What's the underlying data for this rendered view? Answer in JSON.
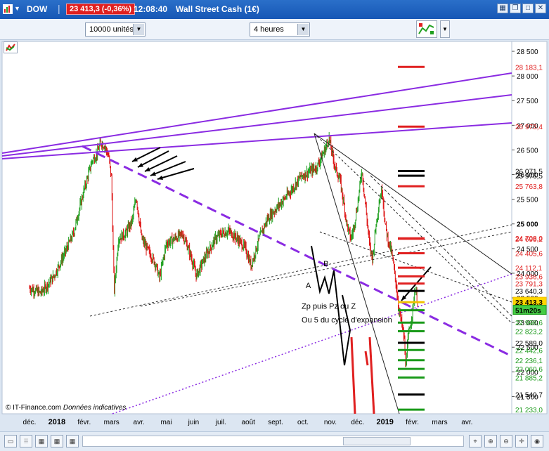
{
  "titlebar": {
    "symbol": "DOW",
    "price_change": "23 413,3 (-0,36%)",
    "time": "12:08:40",
    "instrument": "Wall Street Cash (1€)"
  },
  "toolbar": {
    "units_value": "10000 unités",
    "timeframe_value": "4 heures"
  },
  "footer": {
    "copyright": "© IT-Finance.com",
    "disclaimer": "Données indicatives"
  },
  "colors": {
    "up": "#20a020",
    "down": "#dd1010",
    "trendline": "#8a2be2",
    "accent_red": "#e02020",
    "accent_green": "#1a9a1a"
  },
  "chart_data": {
    "type": "candlestick",
    "x_tick_labels": [
      "déc.",
      "2018",
      "févr.",
      "mars",
      "avr.",
      "mai",
      "juin",
      "juil.",
      "août",
      "sept.",
      "oct.",
      "nov.",
      "déc.",
      "2019",
      "févr.",
      "mars",
      "avr."
    ],
    "y_tick_labels": [
      "28 500",
      "28 000",
      "27 500",
      "27 000",
      "26 500",
      "26 000",
      "25 500",
      "25 000",
      "24 500",
      "24 000",
      "23 500",
      "23 000",
      "22 500",
      "22 000",
      "21 500"
    ],
    "ylim": [
      21150,
      28700
    ],
    "price_tags": [
      {
        "label": "28 183,1",
        "value": 28183.1,
        "color": "#e02020",
        "text": "#e02020"
      },
      {
        "label": "26 973,4",
        "value": 26973.4,
        "color": "#e02020",
        "text": "#e02020"
      },
      {
        "label": "26 071,5",
        "value": 26071.5,
        "color": "#000000",
        "text": "#000000"
      },
      {
        "label": "25 976,5",
        "value": 25976.5,
        "color": "#000000",
        "text": "#000000"
      },
      {
        "label": "25 763,8",
        "value": 25763.8,
        "color": "#e02020",
        "text": "#e02020"
      },
      {
        "label": "24 708,0",
        "value": 24708.0,
        "color": "#e02020",
        "text": "#e02020"
      },
      {
        "label": "24 699,2",
        "value": 24699.2,
        "color": "#e02020",
        "text": "#e02020"
      },
      {
        "label": "24 405,6",
        "value": 24405.6,
        "color": "#e02020",
        "text": "#e02020"
      },
      {
        "label": "24 112,1",
        "value": 24112.1,
        "color": "#e02020",
        "text": "#e02020"
      },
      {
        "label": "23 936,6",
        "value": 23936.6,
        "color": "#e02020",
        "text": "#e02020"
      },
      {
        "label": "23 791,3",
        "value": 23791.3,
        "color": "#e02020",
        "text": "#e02020"
      },
      {
        "label": "23 640,3",
        "value": 23640.3,
        "color": "#000000",
        "text": "#000000"
      },
      {
        "label": "23 413,3",
        "value": 23413.3,
        "color": "#f0c000",
        "text": "#000000",
        "fill": "#ffd700"
      },
      {
        "label": "51m20s",
        "value": 23250,
        "color": "#1a9a1a",
        "text": "#000000",
        "fill": "#44cc44"
      },
      {
        "label": "22 998,6",
        "value": 22998.6,
        "color": "#1a9a1a",
        "text": "#1a9a1a"
      },
      {
        "label": "22 823,2",
        "value": 22823.2,
        "color": "#1a9a1a",
        "text": "#1a9a1a"
      },
      {
        "label": "22 589,0",
        "value": 22589.0,
        "color": "#000000",
        "text": "#000000"
      },
      {
        "label": "22 442,6",
        "value": 22442.6,
        "color": "#1a9a1a",
        "text": "#1a9a1a"
      },
      {
        "label": "22 236,1",
        "value": 22236.1,
        "color": "#1a9a1a",
        "text": "#1a9a1a"
      },
      {
        "label": "22 060,6",
        "value": 22060.6,
        "color": "#1a9a1a",
        "text": "#1a9a1a"
      },
      {
        "label": "21 885,2",
        "value": 21885.2,
        "color": "#1a9a1a",
        "text": "#1a9a1a"
      },
      {
        "label": "21 540,7",
        "value": 21540.7,
        "color": "#000000",
        "text": "#000000"
      },
      {
        "label": "21 233,0",
        "value": 21233.0,
        "color": "#1a9a1a",
        "text": "#1a9a1a"
      }
    ],
    "annotations": [
      {
        "text": "A",
        "time": 10.1,
        "value": 23700
      },
      {
        "text": "B",
        "time": 10.75,
        "value": 24140
      },
      {
        "text": "Zp puis Pz ou Z",
        "time": 9.95,
        "value": 23280
      },
      {
        "text": "Ou 5 du cycle d'expansion",
        "time": 9.95,
        "value": 23000
      }
    ],
    "path_anchors": [
      [
        0.0,
        23700
      ],
      [
        0.2,
        23650
      ],
      [
        0.4,
        23600
      ],
      [
        0.6,
        23720
      ],
      [
        0.9,
        23950
      ],
      [
        1.2,
        24300
      ],
      [
        1.6,
        24800
      ],
      [
        2.0,
        25700
      ],
      [
        2.3,
        26300
      ],
      [
        2.45,
        26400
      ],
      [
        2.6,
        26650
      ],
      [
        2.75,
        26580
      ],
      [
        2.9,
        26350
      ],
      [
        3.0,
        25900
      ],
      [
        3.05,
        24600
      ],
      [
        3.1,
        23650
      ],
      [
        3.25,
        24700
      ],
      [
        3.5,
        24800
      ],
      [
        3.75,
        25050
      ],
      [
        3.9,
        25550
      ],
      [
        4.1,
        24700
      ],
      [
        4.3,
        24500
      ],
      [
        4.6,
        24200
      ],
      [
        4.75,
        23900
      ],
      [
        5.0,
        24600
      ],
      [
        5.3,
        24700
      ],
      [
        5.6,
        24800
      ],
      [
        5.9,
        24350
      ],
      [
        6.1,
        23950
      ],
      [
        6.4,
        24300
      ],
      [
        6.8,
        24700
      ],
      [
        7.0,
        24800
      ],
      [
        7.3,
        24850
      ],
      [
        7.6,
        24700
      ],
      [
        7.9,
        24500
      ],
      [
        8.1,
        24150
      ],
      [
        8.4,
        24700
      ],
      [
        8.7,
        25100
      ],
      [
        9.0,
        25300
      ],
      [
        9.3,
        25500
      ],
      [
        9.6,
        25700
      ],
      [
        9.9,
        25950
      ],
      [
        10.2,
        26050
      ],
      [
        10.5,
        26150
      ],
      [
        10.8,
        26500
      ],
      [
        10.95,
        26750
      ],
      [
        11.0,
        26600
      ],
      [
        11.2,
        26100
      ],
      [
        11.35,
        25900
      ],
      [
        11.5,
        25400
      ],
      [
        11.6,
        25000
      ],
      [
        11.75,
        24700
      ],
      [
        11.85,
        24900
      ],
      [
        12.0,
        25400
      ],
      [
        12.15,
        26100
      ],
      [
        12.3,
        25300
      ],
      [
        12.45,
        24500
      ],
      [
        12.55,
        24300
      ],
      [
        12.65,
        24900
      ],
      [
        12.8,
        25500
      ],
      [
        12.9,
        25700
      ],
      [
        13.0,
        25000
      ],
      [
        13.1,
        24700
      ],
      [
        13.25,
        24400
      ],
      [
        13.4,
        23800
      ],
      [
        13.5,
        23300
      ],
      [
        13.6,
        23000
      ],
      [
        13.7,
        22700
      ],
      [
        13.75,
        22100
      ],
      [
        13.85,
        22700
      ],
      [
        14.0,
        23200
      ],
      [
        14.1,
        23700
      ],
      [
        14.2,
        23400
      ]
    ]
  }
}
